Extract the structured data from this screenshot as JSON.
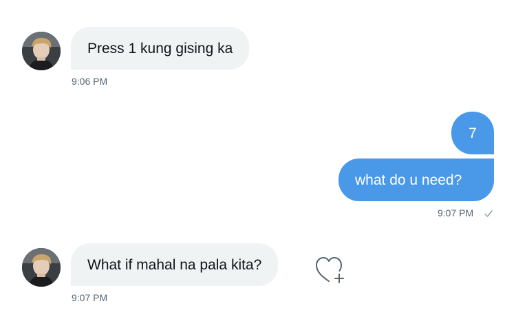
{
  "conversation": {
    "messages": [
      {
        "direction": "received",
        "text": "Press 1 kung gising ka",
        "time": "9:06 PM"
      },
      {
        "direction": "sent",
        "text": "7"
      },
      {
        "direction": "sent",
        "text": "what do u need?",
        "time": "9:07 PM",
        "status_icon": "checkmark-icon"
      },
      {
        "direction": "received",
        "text": "What if mahal na pala kita?",
        "time": "9:07 PM",
        "action_icon": "heart-plus-icon"
      }
    ]
  },
  "colors": {
    "sent_bubble": "#4a99e9",
    "received_bubble": "#eff3f4",
    "timestamp": "#536471"
  }
}
